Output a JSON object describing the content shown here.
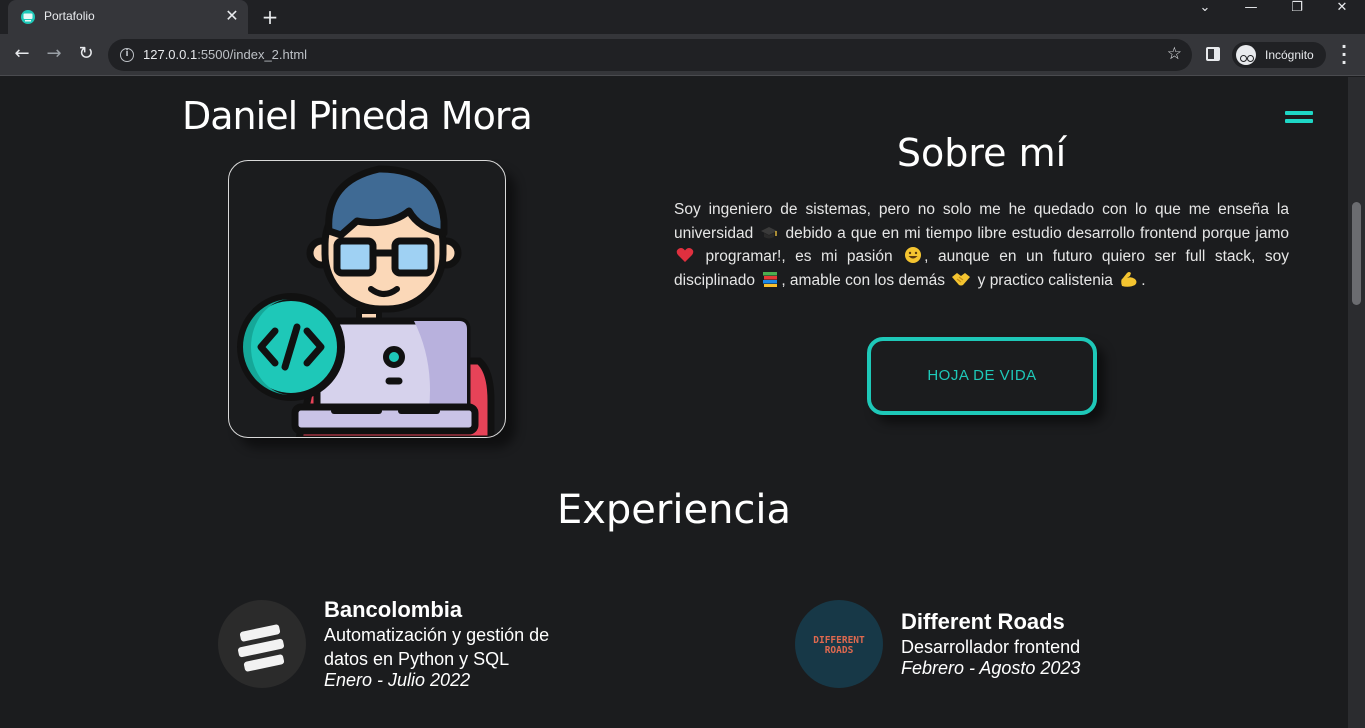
{
  "browser": {
    "tab_title": "Portafolio",
    "url_host": "127.0.0.1",
    "url_rest": ":5500/index_2.html",
    "profile_label": "Incógnito"
  },
  "header": {
    "name": "Daniel Pineda Mora"
  },
  "about": {
    "title": "Sobre mí",
    "text_parts": [
      "Soy ingeniero de sistemas, pero no solo me he quedado con lo que me enseña la universidad ",
      " debido a que en mi tiempo libre estudio desarrollo frontend porque jamo ",
      " programar!, es mi pasión ",
      ", aunque en un futuro quiero ser full stack, soy disciplinado ",
      ", amable con los demás ",
      " y practico calistenia ",
      "."
    ],
    "emojis": [
      "graduation-cap-icon",
      "heart-icon",
      "smile-icon",
      "books-icon",
      "handshake-icon",
      "flexed-biceps-icon"
    ],
    "cv_button_label": "HOJA DE VIDA"
  },
  "experience": {
    "title": "Experiencia",
    "items": [
      {
        "company": "Bancolombia",
        "role": "Automatización y gestión de datos en Python y SQL",
        "dates": "Enero - Julio 2022",
        "logo": "bancolombia-logo-icon"
      },
      {
        "company": "Different Roads",
        "role": "Desarrollador frontend",
        "dates": "Febrero - Agosto 2023",
        "logo": "different-roads-logo-icon",
        "logo_text_1": "DIFFERENT",
        "logo_text_2": "ROADS"
      }
    ]
  },
  "colors": {
    "accent": "#1ec8b8",
    "background": "#1b1c1e"
  }
}
